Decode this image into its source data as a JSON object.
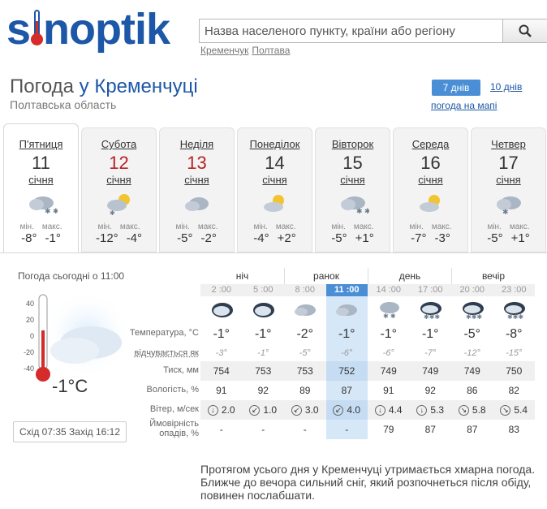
{
  "logo": {
    "text_before": "s",
    "text_after": "noptik"
  },
  "search": {
    "placeholder": "Назва населеного пункту, країни або регіону"
  },
  "recent": [
    "Кременчук",
    "Полтава"
  ],
  "city": {
    "prefix": "Погода",
    "name": "у Кременчуці",
    "region": "Полтавська область"
  },
  "tabs": {
    "seven": "7 днів",
    "ten": "10 днів",
    "map": "погода на мапі"
  },
  "days": [
    {
      "name": "П'ятниця",
      "num": "11",
      "month": "січня",
      "min_label": "мін.",
      "max_label": "макс.",
      "min": "-8°",
      "max": "-1°",
      "red": false,
      "icon": "snow-cloud-icon"
    },
    {
      "name": "Субота",
      "num": "12",
      "month": "січня",
      "min_label": "мін.",
      "max_label": "макс.",
      "min": "-12°",
      "max": "-4°",
      "red": true,
      "icon": "sun-cloud-snow-icon"
    },
    {
      "name": "Неділя",
      "num": "13",
      "month": "січня",
      "min_label": "мін.",
      "max_label": "макс.",
      "min": "-5°",
      "max": "-2°",
      "red": true,
      "icon": "cloud-icon"
    },
    {
      "name": "Понеділок",
      "num": "14",
      "month": "січня",
      "min_label": "мін.",
      "max_label": "макс.",
      "min": "-4°",
      "max": "+2°",
      "red": false,
      "icon": "sun-cloud-icon"
    },
    {
      "name": "Вівторок",
      "num": "15",
      "month": "січня",
      "min_label": "мін.",
      "max_label": "макс.",
      "min": "-5°",
      "max": "+1°",
      "red": false,
      "icon": "snow-cloud-icon"
    },
    {
      "name": "Середа",
      "num": "16",
      "month": "січня",
      "min_label": "мін.",
      "max_label": "макс.",
      "min": "-7°",
      "max": "-3°",
      "red": false,
      "icon": "sun-cloud-icon"
    },
    {
      "name": "Четвер",
      "num": "17",
      "month": "січня",
      "min_label": "мін.",
      "max_label": "макс.",
      "min": "-5°",
      "max": "+1°",
      "red": false,
      "icon": "snow-cloud-icon"
    }
  ],
  "today": {
    "title": "Погода сьогодні о 11:00",
    "temp": "-1°C",
    "scale": [
      "40",
      "20",
      "0",
      "-20",
      "-40"
    ],
    "sunrise_label": "Схід",
    "sunrise": "07:35",
    "sunset_label": "Захід",
    "sunset": "16:12"
  },
  "row_labels": {
    "temp": "Температура, °C",
    "feels": "відчувається як",
    "pressure": "Тиск, мм",
    "humidity": "Вологість, %",
    "wind": "Вітер, м/сек",
    "precip": "Ймовірність опадів, %"
  },
  "periods": [
    "ніч",
    "ранок",
    "день",
    "вечір"
  ],
  "hours": [
    {
      "time": "2 :00",
      "temp": "-1°",
      "feels": "-3°",
      "pressure": "754",
      "humidity": "91",
      "wind_dir": "↓",
      "wind": "2.0",
      "precip": "-",
      "icon": "dark-cloud-icon"
    },
    {
      "time": "5 :00",
      "temp": "-1°",
      "feels": "-1°",
      "pressure": "753",
      "humidity": "92",
      "wind_dir": "↙",
      "wind": "1.0",
      "precip": "-",
      "icon": "dark-cloud-icon"
    },
    {
      "time": "8 :00",
      "temp": "-2°",
      "feels": "-5°",
      "pressure": "753",
      "humidity": "89",
      "wind_dir": "↙",
      "wind": "3.0",
      "precip": "-",
      "icon": "cloud-icon"
    },
    {
      "time": "11 :00",
      "temp": "-1°",
      "feels": "-6°",
      "pressure": "752",
      "humidity": "87",
      "wind_dir": "↙",
      "wind": "4.0",
      "precip": "-",
      "icon": "cloud-icon"
    },
    {
      "time": "14 :00",
      "temp": "-1°",
      "feels": "-6°",
      "pressure": "749",
      "humidity": "91",
      "wind_dir": "↓",
      "wind": "4.4",
      "precip": "79",
      "icon": "snow-cloud-icon"
    },
    {
      "time": "17 :00",
      "temp": "-1°",
      "feels": "-7°",
      "pressure": "749",
      "humidity": "92",
      "wind_dir": "↓",
      "wind": "5.3",
      "precip": "87",
      "icon": "heavy-snow-icon"
    },
    {
      "time": "20 :00",
      "temp": "-5°",
      "feels": "-12°",
      "pressure": "749",
      "humidity": "86",
      "wind_dir": "↘",
      "wind": "5.8",
      "precip": "87",
      "icon": "heavy-snow-icon"
    },
    {
      "time": "23 :00",
      "temp": "-8°",
      "feels": "-15°",
      "pressure": "750",
      "humidity": "82",
      "wind_dir": "↘",
      "wind": "5.4",
      "precip": "83",
      "icon": "heavy-snow-icon"
    }
  ],
  "description": "Протягом усього дня у Кременчуці утримається хмарна погода. Ближче до вечора сильний сніг, який розпочнеться після обіду, повинен послабшати."
}
